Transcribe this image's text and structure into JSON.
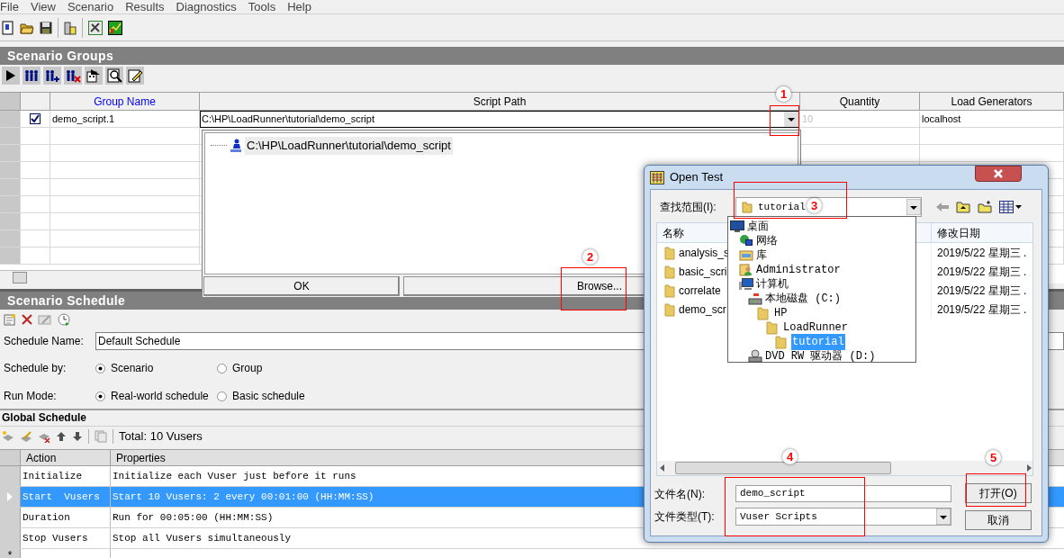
{
  "menu": [
    {
      "label": "File"
    },
    {
      "label": "View"
    },
    {
      "label": "Scenario"
    },
    {
      "label": "Results"
    },
    {
      "label": "Diagnostics"
    },
    {
      "label": "Tools"
    },
    {
      "label": "Help"
    }
  ],
  "scenario_groups": {
    "title": "Scenario Groups",
    "columns": [
      "Group Name",
      "Script Path",
      "Quantity",
      "Load Generators"
    ],
    "rows": [
      {
        "checked": true,
        "group_name": "demo_script.1",
        "script_path": "C:\\HP\\LoadRunner\\tutorial\\demo_script",
        "quantity": "10",
        "load_generator": "localhost"
      }
    ]
  },
  "script_dropdown": {
    "items": [
      "C:\\HP\\LoadRunner\\tutorial\\demo_script"
    ],
    "buttons": [
      "OK",
      "Browse..."
    ]
  },
  "scenario_schedule": {
    "title": "Scenario Schedule",
    "schedule_name_label": "Schedule Name:",
    "schedule_name": "Default Schedule",
    "schedule_by": {
      "label": "Schedule by:",
      "options": [
        {
          "label": "Scenario",
          "selected": true
        },
        {
          "label": "Group",
          "selected": false
        }
      ]
    },
    "run_mode": {
      "label": "Run Mode:",
      "options": [
        {
          "label": "Real-world schedule",
          "selected": true
        },
        {
          "label": "Basic schedule",
          "selected": false
        }
      ]
    }
  },
  "global_schedule": {
    "title": "Global Schedule",
    "total": "Total: 10 Vusers",
    "columns": [
      "Action",
      "Properties"
    ],
    "rows": [
      {
        "action": "Initialize",
        "properties": "Initialize each Vuser just before it runs",
        "selected": false
      },
      {
        "action": "Start  Vusers",
        "properties": "Start 10 Vusers: 2 every 00:01:00 (HH:MM:SS)",
        "selected": true
      },
      {
        "action": "Duration",
        "properties": "Run for 00:05:00 (HH:MM:SS)",
        "selected": false
      },
      {
        "action": "Stop Vusers",
        "properties": "Stop all Vusers simultaneously",
        "selected": false
      }
    ],
    "new_row_marker": "*"
  },
  "dialog": {
    "title": "Open Test",
    "look_in_label": "查找范围(I):",
    "look_in": "tutorial",
    "columns": [
      "名称",
      "修改日期"
    ],
    "files": [
      {
        "name": "analysis_s",
        "modified": "2019/5/22 星期三 ."
      },
      {
        "name": "basic_scri",
        "modified": "2019/5/22 星期三 ."
      },
      {
        "name": "correlate",
        "modified": "2019/5/22 星期三 ."
      },
      {
        "name": "demo_scr",
        "modified": "2019/5/22 星期三 ."
      }
    ],
    "file_name_label": "文件名(N):",
    "file_name": "demo_script",
    "file_type_label": "文件类型(T):",
    "file_type": "Vuser Scripts",
    "buttons": [
      "打开(O)",
      "取消"
    ],
    "location_tree": [
      {
        "label": "桌面",
        "kind": "desktop",
        "selected": false,
        "children": [
          {
            "label": "网络",
            "kind": "network",
            "selected": false
          },
          {
            "label": "库",
            "kind": "library",
            "selected": false
          },
          {
            "label": "Administrator",
            "kind": "user",
            "selected": false
          },
          {
            "label": "计算机",
            "kind": "computer",
            "selected": false,
            "children": [
              {
                "label": "本地磁盘 (C:)",
                "kind": "drive",
                "selected": false,
                "children": [
                  {
                    "label": "HP",
                    "kind": "folder",
                    "selected": false,
                    "children": [
                      {
                        "label": "LoadRunner",
                        "kind": "folder",
                        "selected": false,
                        "children": [
                          {
                            "label": "tutorial",
                            "kind": "folder",
                            "selected": true
                          }
                        ]
                      }
                    ]
                  }
                ]
              },
              {
                "label": "DVD RW 驱动器 (D:)",
                "kind": "dvd",
                "selected": false
              }
            ]
          }
        ]
      }
    ]
  },
  "annotations": [
    {
      "label": "1"
    },
    {
      "label": "2"
    },
    {
      "label": "3"
    },
    {
      "label": "4"
    },
    {
      "label": "5"
    }
  ]
}
